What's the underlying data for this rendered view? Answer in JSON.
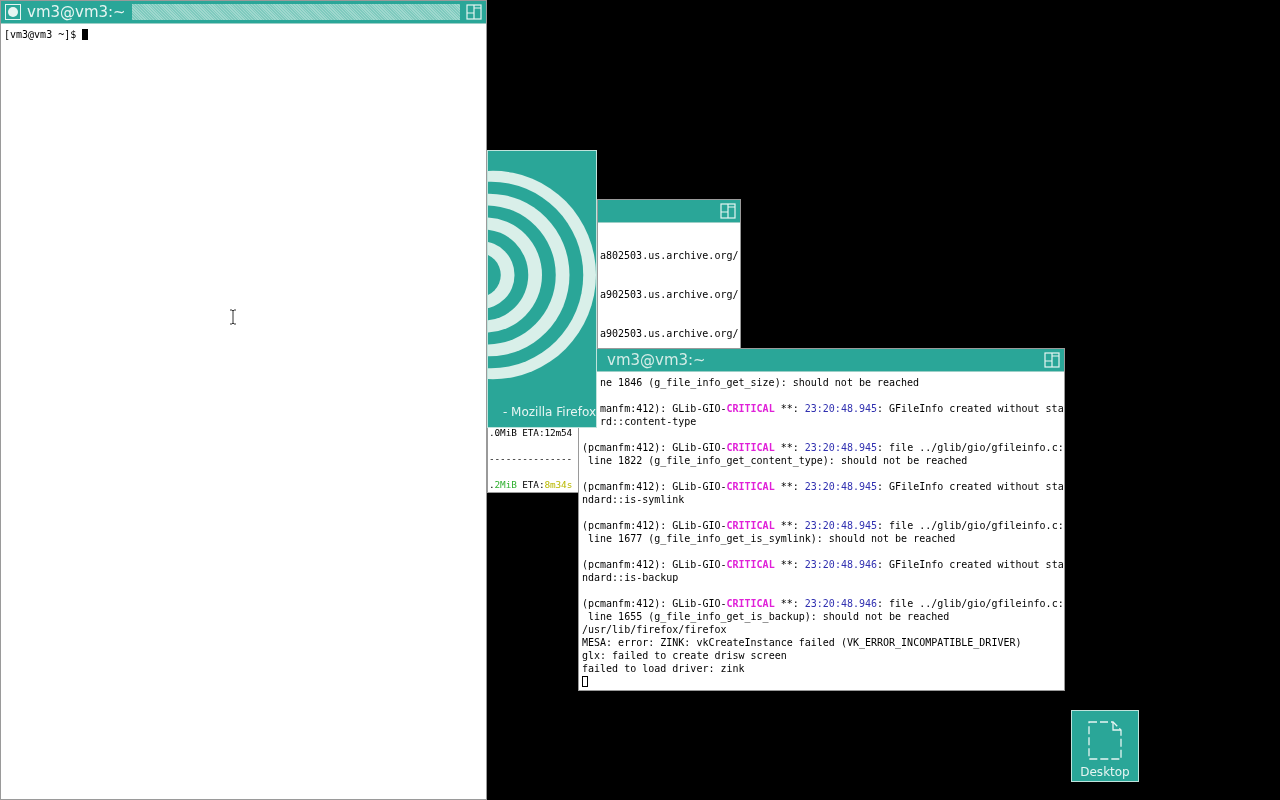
{
  "windows": [
    {
      "kind": "terminal",
      "title": "vm3@vm3:~",
      "focused": true,
      "lines": [
        {
          "parts": [
            {
              "text": "[vm3@vm3 ~]$ ",
              "kind": "plain"
            }
          ],
          "cursor": true
        }
      ]
    },
    {
      "kind": "terminal",
      "lines": [
        {
          "parts": [
            {
              "text": ".0MiB ETA:12m54",
              "kind": "plain"
            }
          ]
        },
        {
          "blank": true
        },
        {
          "parts": [
            {
              "text": "---------------",
              "kind": "plain"
            }
          ]
        },
        {
          "blank": true
        },
        {
          "parts": [
            {
              "text": ".",
              "kind": "plain"
            },
            {
              "text": "2MiB",
              "kind": "size"
            },
            {
              "text": " ETA:",
              "kind": "plain"
            },
            {
              "text": "8m34s",
              "kind": "eta"
            }
          ]
        }
      ]
    },
    {
      "kind": "terminal",
      "lines": [
        {
          "blank": true
        },
        {
          "blank": true
        },
        {
          "parts": [
            {
              "text": "a802503.us.archive.org/",
              "kind": "plain"
            }
          ]
        },
        {
          "blank": true
        },
        {
          "blank": true
        },
        {
          "parts": [
            {
              "text": "a902503.us.archive.org/",
              "kind": "plain"
            }
          ]
        },
        {
          "blank": true
        },
        {
          "blank": true
        },
        {
          "parts": [
            {
              "text": "a902503.us.archive.org/",
              "kind": "plain"
            }
          ]
        }
      ]
    },
    {
      "kind": "terminal",
      "title": "vm3@vm3:~",
      "focused": false,
      "lines": [
        {
          "clipped": true,
          "parts": [
            {
              "text": "ne 1846 (g_file_info_get_size): should not be reached",
              "kind": "plain"
            }
          ]
        },
        {
          "blank": true
        },
        {
          "clipped": true,
          "parts": [
            {
              "text": "manfm:412): GLib-GIO-",
              "kind": "plain"
            },
            {
              "text": "CRITICAL",
              "kind": "critical"
            },
            {
              "text": " **: ",
              "kind": "plain"
            },
            {
              "text": "23:20:48.945",
              "kind": "time"
            },
            {
              "text": ": GFileInfo created without sta",
              "kind": "plain"
            }
          ]
        },
        {
          "clipped": true,
          "parts": [
            {
              "text": "rd::content-type",
              "kind": "plain"
            }
          ]
        },
        {
          "blank": true
        },
        {
          "parts": [
            {
              "text": "(pcmanfm:412): GLib-GIO-",
              "kind": "plain"
            },
            {
              "text": "CRITICAL",
              "kind": "critical"
            },
            {
              "text": " **: ",
              "kind": "plain"
            },
            {
              "text": "23:20:48.945",
              "kind": "time"
            },
            {
              "text": ": file ../glib/gio/gfileinfo.c:",
              "kind": "plain"
            }
          ]
        },
        {
          "parts": [
            {
              "text": " line 1822 (g_file_info_get_content_type): should not be reached",
              "kind": "plain"
            }
          ]
        },
        {
          "blank": true
        },
        {
          "parts": [
            {
              "text": "(pcmanfm:412): GLib-GIO-",
              "kind": "plain"
            },
            {
              "text": "CRITICAL",
              "kind": "critical"
            },
            {
              "text": " **: ",
              "kind": "plain"
            },
            {
              "text": "23:20:48.945",
              "kind": "time"
            },
            {
              "text": ": GFileInfo created without sta",
              "kind": "plain"
            }
          ]
        },
        {
          "parts": [
            {
              "text": "ndard::is-symlink",
              "kind": "plain"
            }
          ]
        },
        {
          "blank": true
        },
        {
          "parts": [
            {
              "text": "(pcmanfm:412): GLib-GIO-",
              "kind": "plain"
            },
            {
              "text": "CRITICAL",
              "kind": "critical"
            },
            {
              "text": " **: ",
              "kind": "plain"
            },
            {
              "text": "23:20:48.945",
              "kind": "time"
            },
            {
              "text": ": file ../glib/gio/gfileinfo.c:",
              "kind": "plain"
            }
          ]
        },
        {
          "parts": [
            {
              "text": " line 1677 (g_file_info_get_is_symlink): should not be reached",
              "kind": "plain"
            }
          ]
        },
        {
          "blank": true
        },
        {
          "parts": [
            {
              "text": "(pcmanfm:412): GLib-GIO-",
              "kind": "plain"
            },
            {
              "text": "CRITICAL",
              "kind": "critical"
            },
            {
              "text": " **: ",
              "kind": "plain"
            },
            {
              "text": "23:20:48.946",
              "kind": "time"
            },
            {
              "text": ": GFileInfo created without sta",
              "kind": "plain"
            }
          ]
        },
        {
          "parts": [
            {
              "text": "ndard::is-backup",
              "kind": "plain"
            }
          ]
        },
        {
          "blank": true
        },
        {
          "parts": [
            {
              "text": "(pcmanfm:412): GLib-GIO-",
              "kind": "plain"
            },
            {
              "text": "CRITICAL",
              "kind": "critical"
            },
            {
              "text": " **: ",
              "kind": "plain"
            },
            {
              "text": "23:20:48.946",
              "kind": "time"
            },
            {
              "text": ": file ../glib/gio/gfileinfo.c:",
              "kind": "plain"
            }
          ]
        },
        {
          "parts": [
            {
              "text": " line 1655 (g_file_info_get_is_backup): should not be reached",
              "kind": "plain"
            }
          ]
        },
        {
          "parts": [
            {
              "text": "/usr/lib/firefox/firefox",
              "kind": "plain"
            }
          ]
        },
        {
          "parts": [
            {
              "text": "MESA: error: ZINK: vkCreateInstance failed (VK_ERROR_INCOMPATIBLE_DRIVER)",
              "kind": "plain"
            }
          ]
        },
        {
          "parts": [
            {
              "text": "glx: failed to create drisw screen",
              "kind": "plain"
            }
          ]
        },
        {
          "parts": [
            {
              "text": "failed to load driver: zink",
              "kind": "plain"
            }
          ]
        },
        {
          "cursor": true
        }
      ]
    },
    {
      "kind": "splash",
      "title": "- Mozilla Firefox"
    }
  ],
  "desktop_icons": [
    {
      "label": "Desktop"
    }
  ]
}
